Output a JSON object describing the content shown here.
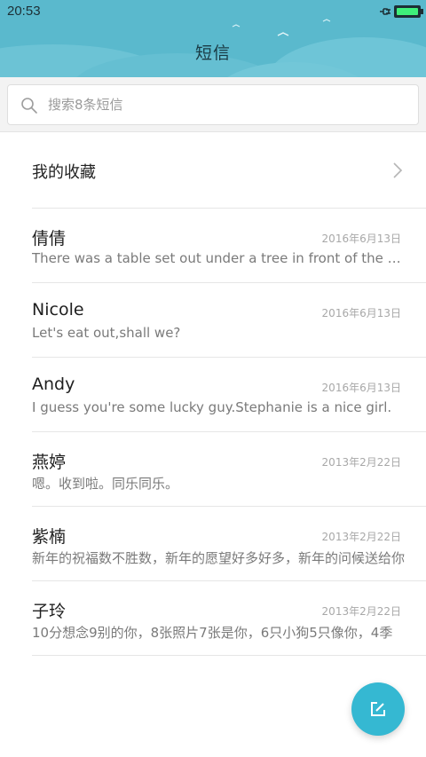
{
  "status": {
    "time": "20:53"
  },
  "header": {
    "title": "短信"
  },
  "search": {
    "placeholder": "搜索8条短信"
  },
  "favorites": {
    "label": "我的收藏"
  },
  "messages": [
    {
      "name": "倩倩",
      "date": "2016年6月13日",
      "preview": "There was a table set out under a tree in front of the house"
    },
    {
      "name": "Nicole",
      "date": "2016年6月13日",
      "preview": "Let's eat out,shall we?"
    },
    {
      "name": "Andy",
      "date": "2016年6月13日",
      "preview": "I guess you're some lucky guy.Stephanie is a nice girl."
    },
    {
      "name": "燕婷",
      "date": "2013年2月22日",
      "preview": "嗯。收到啦。同乐同乐。"
    },
    {
      "name": "紫楠",
      "date": "2013年2月22日",
      "preview": "新年的祝福数不胜数，新年的愿望好多好多，新年的问候送给你"
    },
    {
      "name": "子玲",
      "date": "2013年2月22日",
      "preview": "10分想念9别的你，8张照片7张是你，6只小狗5只像你，4季"
    }
  ],
  "colors": {
    "header": "#5ab9cd",
    "fab": "#35b8d2",
    "battery": "#3ff07a"
  },
  "icons": [
    "plug-icon",
    "battery-icon",
    "search-icon",
    "chevron-right-icon",
    "compose-icon"
  ]
}
